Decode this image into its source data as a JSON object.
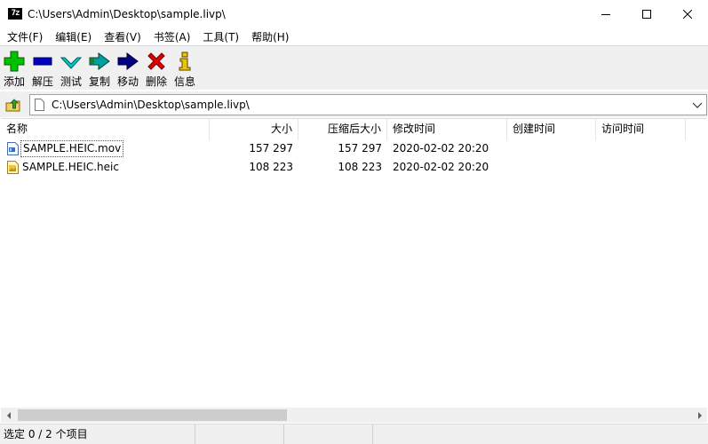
{
  "window": {
    "app_icon_text": "7z",
    "title": "C:\\Users\\Admin\\Desktop\\sample.livp\\"
  },
  "menu": [
    "文件(F)",
    "编辑(E)",
    "查看(V)",
    "书签(A)",
    "工具(T)",
    "帮助(H)"
  ],
  "toolbar": {
    "add": "添加",
    "extract": "解压",
    "test": "测试",
    "copy": "复制",
    "move": "移动",
    "delete": "删除",
    "info": "信息"
  },
  "address": {
    "path": "C:\\Users\\Admin\\Desktop\\sample.livp\\"
  },
  "columns": {
    "name": "名称",
    "size": "大小",
    "packed": "压缩后大小",
    "modified": "修改时间",
    "created": "创建时间",
    "accessed": "访问时间"
  },
  "files": [
    {
      "name": "SAMPLE.HEIC.mov",
      "size": "157 297",
      "packed": "157 297",
      "modified": "2020-02-02 20:20",
      "icon": "video-file-icon"
    },
    {
      "name": "SAMPLE.HEIC.heic",
      "size": "108 223",
      "packed": "108 223",
      "modified": "2020-02-02 20:20",
      "icon": "image-file-icon"
    }
  ],
  "scroll": {
    "thumb_fraction": 0.4
  },
  "status": {
    "selection": "选定 0 / 2 个项目"
  },
  "colors": {
    "add": "#00c000",
    "extract": "#0000c0",
    "test": "#00c0c0",
    "copy": "#008080",
    "move": "#000080",
    "delete": "#e00000",
    "info": "#e0c000"
  }
}
